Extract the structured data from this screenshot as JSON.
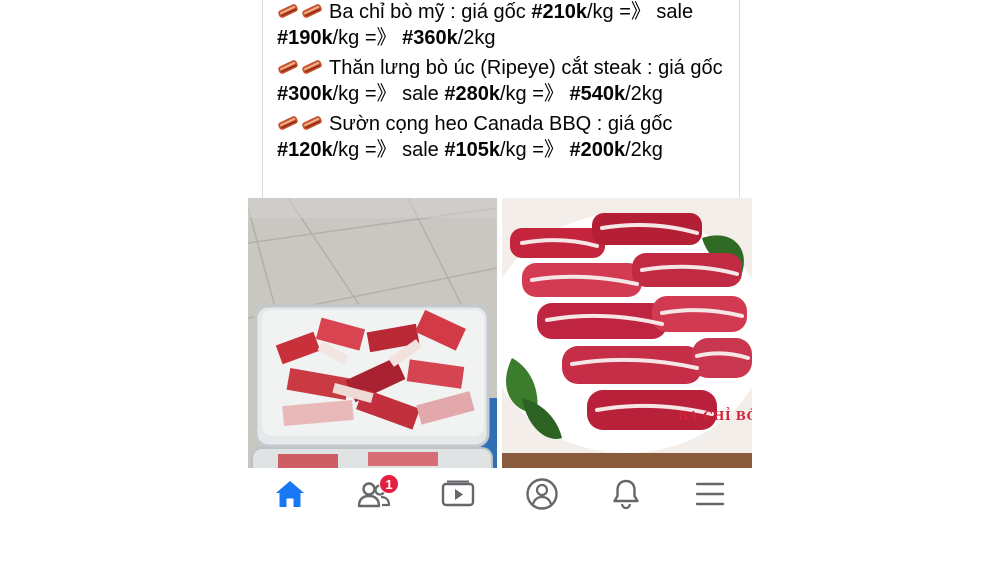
{
  "post": {
    "lines": [
      {
        "text_a": "Ba chỉ bò mỹ : giá gốc ",
        "price_orig": "#210k",
        "text_b": "/kg =》 sale ",
        "price_sale": "#190k",
        "text_c": "/kg =》 ",
        "price_2kg": "#360k",
        "text_d": "/2kg"
      },
      {
        "text_a": "Thăn lưng bò úc (Ripeye) cắt steak : giá gốc ",
        "price_orig": "#300k",
        "text_b": "/kg =》 sale ",
        "price_sale": "#280k",
        "text_c": "/kg =》 ",
        "price_2kg": "#540k",
        "text_d": "/2kg"
      },
      {
        "text_a": "Sườn cọng heo Canada BBQ : giá gốc ",
        "price_orig": "#120k",
        "text_b": "/kg =》 sale ",
        "price_sale": "#105k",
        "text_c": "/kg =》 ",
        "price_2kg": "#200k",
        "text_d": "/2kg"
      }
    ]
  },
  "photos": {
    "right_caption": "BA CHỈ BÒ"
  },
  "nav": {
    "friends_badge": "1",
    "icons": [
      "home-icon",
      "friends-icon",
      "watch-icon",
      "profile-icon",
      "bell-icon",
      "menu-icon"
    ],
    "active_color": "#1877f2",
    "inactive_color": "#65676b"
  }
}
